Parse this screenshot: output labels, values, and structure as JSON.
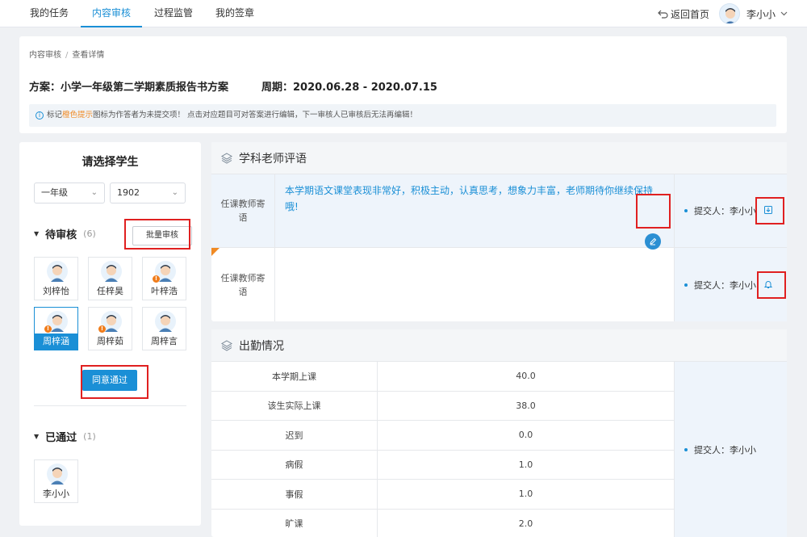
{
  "nav": {
    "tabs": [
      {
        "label": "我的任务"
      },
      {
        "label": "内容审核"
      },
      {
        "label": "过程监管"
      },
      {
        "label": "我的签章"
      }
    ],
    "back_label": "返回首页",
    "user_name": "李小小"
  },
  "header": {
    "breadcrumb": [
      "内容审核",
      "查看详情"
    ],
    "plan": "方案：小学一年级第二学期素质报告书方案",
    "period": "周期：2020.06.28 - 2020.07.15",
    "notice_prefix": "标记",
    "notice_highlight": "橙色提示",
    "notice_suffix": "图标为作答者为未提交项！ 点击对应题目可对答案进行编辑，下一审核人已审核后无法再编辑！"
  },
  "left": {
    "title": "请选择学生",
    "grade": "一年级",
    "class": "1902",
    "pending_label": "待审核",
    "pending_count": "(6)",
    "batch_button": "批量审核",
    "students": [
      {
        "name": "刘梓怡",
        "warn": false,
        "selected": false
      },
      {
        "name": "任梓昊",
        "warn": false,
        "selected": false
      },
      {
        "name": "叶梓浩",
        "warn": true,
        "selected": false
      },
      {
        "name": "周梓涵",
        "warn": true,
        "selected": true
      },
      {
        "name": "周梓茹",
        "warn": true,
        "selected": false
      },
      {
        "name": "周梓言",
        "warn": false,
        "selected": false
      }
    ],
    "agree_button": "同意通过",
    "passed_label": "已通过",
    "passed_count": "(1)",
    "passed_students": [
      {
        "name": "李小小"
      }
    ]
  },
  "comments": {
    "title": "学科老师评语",
    "rows": [
      {
        "label": "任课教师寄语",
        "text": "本学期语文课堂表现非常好，积极主动，认真思考，想象力丰富，老师期待你继续保持哦!",
        "submitter": "提交人：李小小"
      },
      {
        "label": "任课教师寄语",
        "text": "",
        "submitter": "提交人：李小小"
      }
    ]
  },
  "attendance": {
    "title": "出勤情况",
    "rows": [
      {
        "label": "本学期上课",
        "value": "40.0"
      },
      {
        "label": "该生实际上课",
        "value": "38.0"
      },
      {
        "label": "迟到",
        "value": "0.0"
      },
      {
        "label": "病假",
        "value": "1.0"
      },
      {
        "label": "事假",
        "value": "1.0"
      },
      {
        "label": "旷课",
        "value": "2.0"
      }
    ],
    "submitter": "提交人：李小小"
  },
  "colors": {
    "accent": "#1a8fd6",
    "warning": "#f08a24",
    "highlight_box": "#e02020"
  }
}
